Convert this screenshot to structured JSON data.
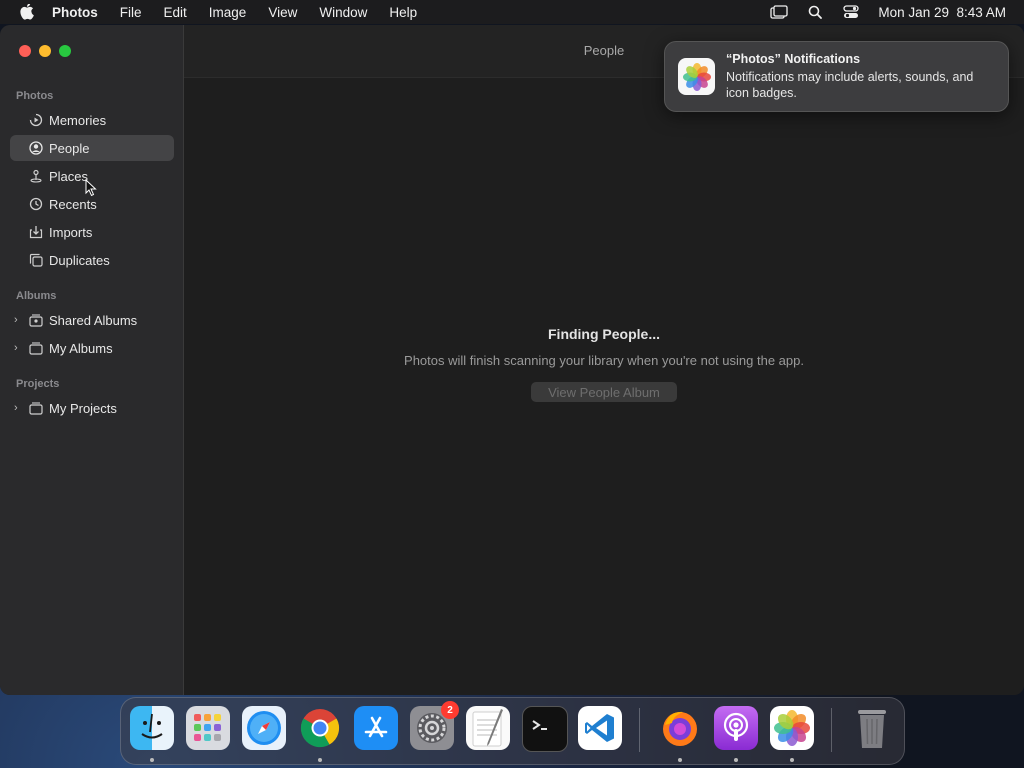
{
  "menubar": {
    "app_name": "Photos",
    "items": [
      "File",
      "Edit",
      "Image",
      "View",
      "Window",
      "Help"
    ],
    "clock": "Mon Jan 29  8:43 AM"
  },
  "sidebar": {
    "sections": [
      {
        "title": "Photos"
      },
      {
        "title": "Albums"
      },
      {
        "title": "Projects"
      }
    ],
    "items": [
      {
        "label": "Memories",
        "icon": "memories-icon"
      },
      {
        "label": "People",
        "icon": "people-icon",
        "selected": true
      },
      {
        "label": "Places",
        "icon": "places-icon"
      },
      {
        "label": "Recents",
        "icon": "recents-icon"
      },
      {
        "label": "Imports",
        "icon": "imports-icon"
      },
      {
        "label": "Duplicates",
        "icon": "duplicates-icon"
      },
      {
        "label": "Shared Albums",
        "icon": "shared-albums-icon"
      },
      {
        "label": "My Albums",
        "icon": "my-albums-icon"
      },
      {
        "label": "My Projects",
        "icon": "my-projects-icon"
      }
    ]
  },
  "window": {
    "title": "People"
  },
  "content": {
    "heading": "Finding People...",
    "message": "Photos will finish scanning your library when you're not using the app.",
    "button": "View People Album"
  },
  "notification": {
    "title": "“Photos” Notifications",
    "body": "Notifications may include alerts, sounds, and icon badges."
  },
  "dock": {
    "items": [
      "finder",
      "launchpad",
      "safari",
      "chrome",
      "app-store",
      "system-settings",
      "textedit",
      "terminal",
      "vscode",
      "firefox",
      "podcasts",
      "photos",
      "trash"
    ],
    "system_settings_badge": "2"
  }
}
